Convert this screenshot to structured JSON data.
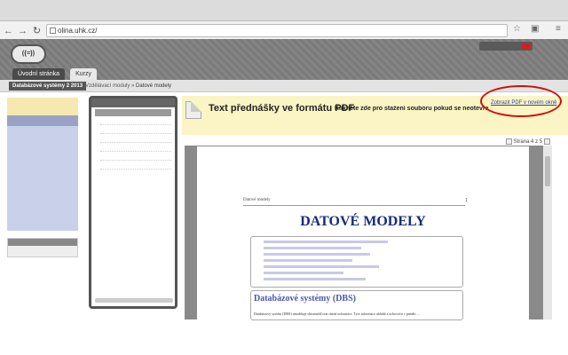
{
  "browser": {
    "url": "olina.uhk.cz/",
    "nav_icons": [
      "back-icon",
      "forward-icon",
      "reload-icon"
    ],
    "right_icons": [
      "star-icon",
      "extension-icon",
      "menu-icon"
    ]
  },
  "site": {
    "logo_text": "({=})",
    "tabs": [
      {
        "label": "Úvodní stránka"
      },
      {
        "label": "Kurzy"
      }
    ]
  },
  "subbar": {
    "course": "Databázové systémy 2 2013",
    "breadcrumb_parent": "Vzdělávací moduly",
    "breadcrumb_current": "Datové modely"
  },
  "content": {
    "title": "Text přednášky ve formátu PDF",
    "hint": "Klikněte zde pro stažení souboru pokud se neotevře",
    "link": "Zobrazit PDF v novém okně",
    "pager": "Strana 4 z 5",
    "highlight_color": "#d20c0c"
  },
  "pdf": {
    "header_left": "Datové modely",
    "header_right": "1",
    "title": "DATOVÉ MODELY",
    "section": "Databázové systémy (DBS)",
    "paragraph": "Databázový systém (DBS) umožňuje shromažďovat různé informace. Tyto informace ukládá a uchovává v paměti ..."
  }
}
